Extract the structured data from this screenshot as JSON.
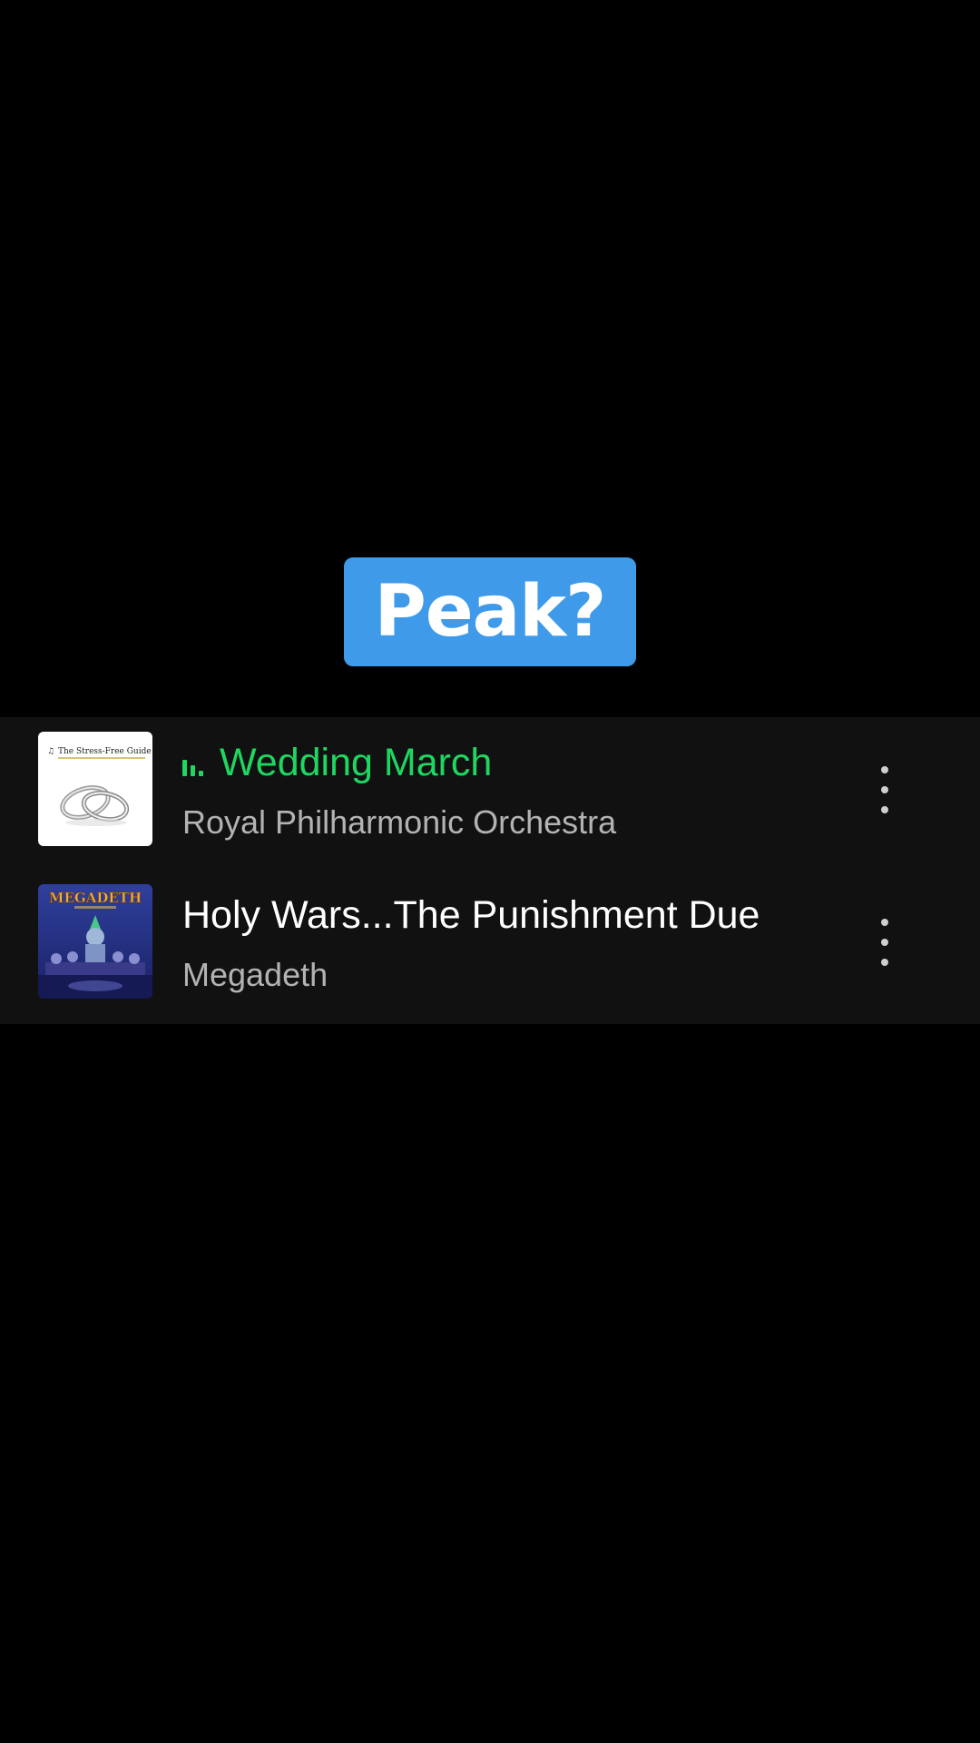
{
  "caption": {
    "text": "Peak?",
    "color": "#3f9be9"
  },
  "colors": {
    "background": "#000000",
    "list_background": "#111112",
    "accent_playing": "#1ed760",
    "title_default": "#ffffff",
    "artist": "#b3b3b3",
    "more_icon": "#cfcfcf"
  },
  "tracks": [
    {
      "title": "Wedding March",
      "artist": "Royal Philharmonic Orchestra",
      "playing": true,
      "cover_icon": "wedding-rings-album-cover",
      "cover_text": "The Stress-Free Guide"
    },
    {
      "title": "Holy Wars...The Punishment Due",
      "artist": "Megadeth",
      "playing": false,
      "cover_icon": "megadeth-rust-in-peace-album-cover",
      "cover_text": "MEGADETH"
    }
  ]
}
